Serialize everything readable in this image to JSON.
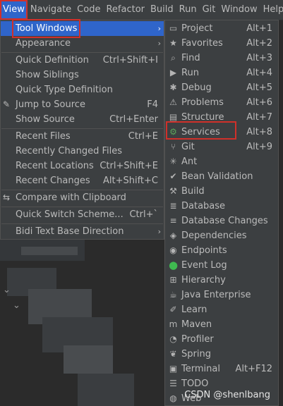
{
  "menubar": [
    "View",
    "Navigate",
    "Code",
    "Refactor",
    "Build",
    "Run",
    "Git",
    "Window",
    "Help"
  ],
  "view_menu": {
    "tool_windows": "Tool Windows",
    "appearance": "Appearance",
    "quick_definition": "Quick Definition",
    "quick_definition_sc": "Ctrl+Shift+I",
    "show_siblings": "Show Siblings",
    "quick_type_definition": "Quick Type Definition",
    "jump_to_source": "Jump to Source",
    "jump_to_source_sc": "F4",
    "show_source": "Show Source",
    "show_source_sc": "Ctrl+Enter",
    "recent_files": "Recent Files",
    "recent_files_sc": "Ctrl+E",
    "recently_changed_files": "Recently Changed Files",
    "recent_locations": "Recent Locations",
    "recent_locations_sc": "Ctrl+Shift+E",
    "recent_changes": "Recent Changes",
    "recent_changes_sc": "Alt+Shift+C",
    "compare_with_clipboard": "Compare with Clipboard",
    "quick_switch_scheme": "Quick Switch Scheme...",
    "quick_switch_scheme_sc": "Ctrl+`",
    "bidi_text": "Bidi Text Base Direction"
  },
  "tool_windows": [
    {
      "label": "Project",
      "shortcut": "Alt+1",
      "icon": "folder-icon"
    },
    {
      "label": "Favorites",
      "shortcut": "Alt+2",
      "icon": "star-icon"
    },
    {
      "label": "Find",
      "shortcut": "Alt+3",
      "icon": "search-icon"
    },
    {
      "label": "Run",
      "shortcut": "Alt+4",
      "icon": "run-icon"
    },
    {
      "label": "Debug",
      "shortcut": "Alt+5",
      "icon": "bug-icon"
    },
    {
      "label": "Problems",
      "shortcut": "Alt+6",
      "icon": "warning-icon"
    },
    {
      "label": "Structure",
      "shortcut": "Alt+7",
      "icon": "structure-icon"
    },
    {
      "label": "Services",
      "shortcut": "Alt+8",
      "icon": "services-icon"
    },
    {
      "label": "Git",
      "shortcut": "Alt+9",
      "icon": "git-icon"
    },
    {
      "label": "Ant",
      "shortcut": "",
      "icon": "ant-icon"
    },
    {
      "label": "Bean Validation",
      "shortcut": "",
      "icon": "bean-icon"
    },
    {
      "label": "Build",
      "shortcut": "",
      "icon": "hammer-icon"
    },
    {
      "label": "Database",
      "shortcut": "",
      "icon": "database-icon"
    },
    {
      "label": "Database Changes",
      "shortcut": "",
      "icon": "database-changes-icon"
    },
    {
      "label": "Dependencies",
      "shortcut": "",
      "icon": "dependencies-icon"
    },
    {
      "label": "Endpoints",
      "shortcut": "",
      "icon": "endpoints-icon"
    },
    {
      "label": "Event Log",
      "shortcut": "",
      "icon": "event-log-icon"
    },
    {
      "label": "Hierarchy",
      "shortcut": "",
      "icon": "hierarchy-icon"
    },
    {
      "label": "Java Enterprise",
      "shortcut": "",
      "icon": "java-enterprise-icon"
    },
    {
      "label": "Learn",
      "shortcut": "",
      "icon": "learn-icon"
    },
    {
      "label": "Maven",
      "shortcut": "",
      "icon": "maven-icon"
    },
    {
      "label": "Profiler",
      "shortcut": "",
      "icon": "profiler-icon"
    },
    {
      "label": "Spring",
      "shortcut": "",
      "icon": "spring-icon"
    },
    {
      "label": "Terminal",
      "shortcut": "Alt+F12",
      "icon": "terminal-icon"
    },
    {
      "label": "TODO",
      "shortcut": "",
      "icon": "todo-icon"
    },
    {
      "label": "Web",
      "shortcut": "",
      "icon": "web-icon"
    }
  ],
  "watermark": "CSDN @shenlbang",
  "colors": {
    "highlight": "#2f65ca",
    "annotation": "#d0302a",
    "event_log": "#3fb950"
  }
}
